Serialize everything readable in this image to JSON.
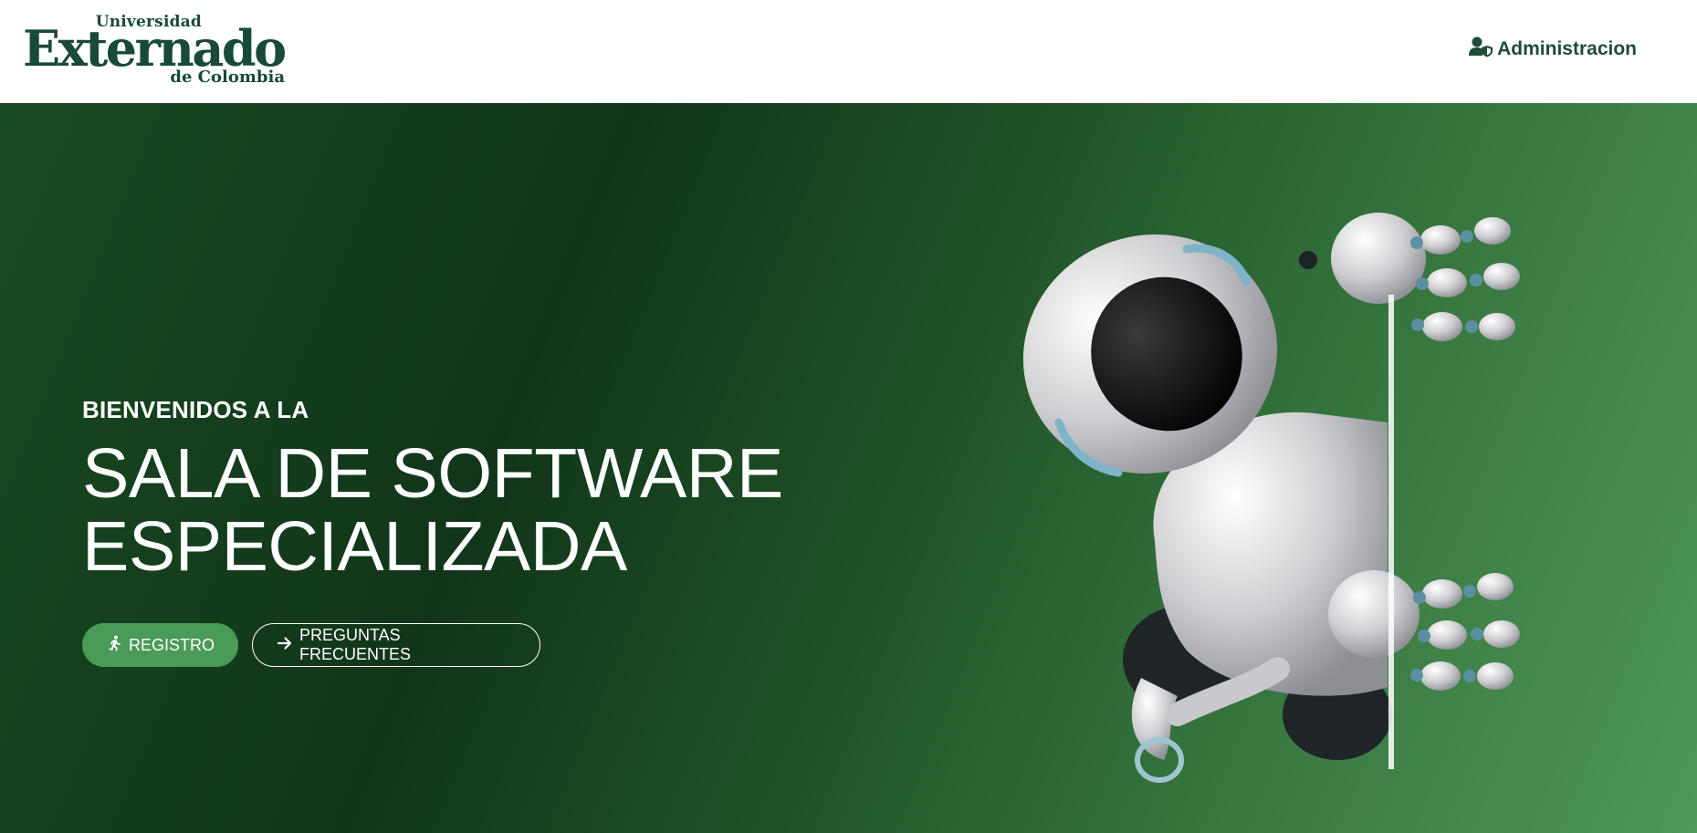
{
  "header": {
    "logo": {
      "line1": "Universidad",
      "line2": "Externado",
      "line3": "de Colombia"
    },
    "admin_link": {
      "icon": "user-shield-icon",
      "label": "Administracion"
    }
  },
  "hero": {
    "eyebrow": "BIENVENIDOS A LA",
    "headline_line1": "SALA DE SOFTWARE",
    "headline_line2": "ESPECIALIZADA",
    "buttons": [
      {
        "label": "REGISTRO",
        "icon": "running-person-icon"
      },
      {
        "label": "PREGUNTAS FRECUENTES",
        "icon": "arrow-right-icon"
      }
    ],
    "illustration": "robot-peeking-illustration"
  },
  "colors": {
    "brand_green_dark": "#184a36",
    "hero_gradient_start": "#123519",
    "hero_gradient_end": "#4e985a",
    "button_primary": "#4a9a58",
    "text_on_hero": "#ffffff"
  }
}
